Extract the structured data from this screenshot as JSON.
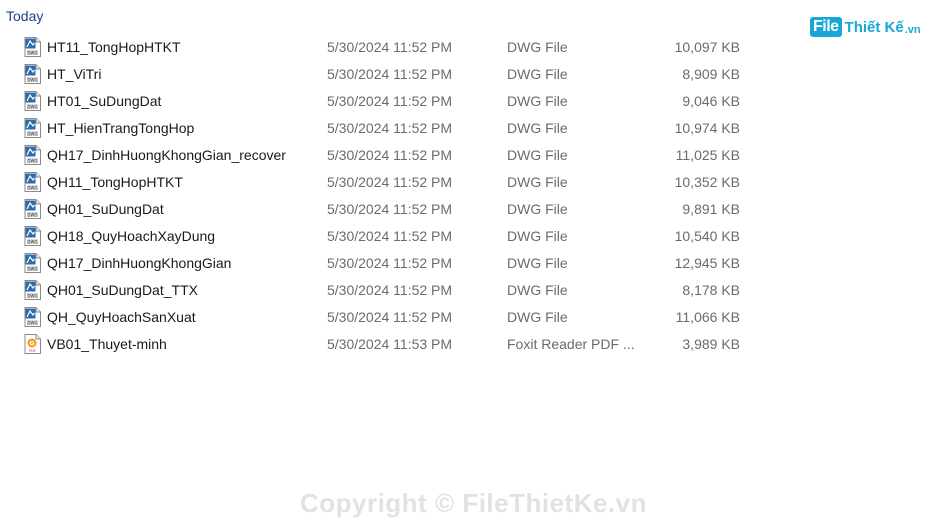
{
  "group_header": "Today",
  "logo": {
    "part1": "File",
    "part2": "Thiết Kế",
    "part3": ".vn",
    "color": "#1aa5d8"
  },
  "files": [
    {
      "name": "HT11_TongHopHTKT",
      "date": "5/30/2024 11:52 PM",
      "type": "DWG File",
      "size": "10,097 KB",
      "icon": "dwg-file-icon"
    },
    {
      "name": "HT_ViTri",
      "date": "5/30/2024 11:52 PM",
      "type": "DWG File",
      "size": "8,909 KB",
      "icon": "dwg-file-icon"
    },
    {
      "name": "HT01_SuDungDat",
      "date": "5/30/2024 11:52 PM",
      "type": "DWG File",
      "size": "9,046 KB",
      "icon": "dwg-file-icon"
    },
    {
      "name": "HT_HienTrangTongHop",
      "date": "5/30/2024 11:52 PM",
      "type": "DWG File",
      "size": "10,974 KB",
      "icon": "dwg-file-icon"
    },
    {
      "name": "QH17_DinhHuongKhongGian_recover",
      "date": "5/30/2024 11:52 PM",
      "type": "DWG File",
      "size": "11,025 KB",
      "icon": "dwg-file-icon"
    },
    {
      "name": "QH11_TongHopHTKT",
      "date": "5/30/2024 11:52 PM",
      "type": "DWG File",
      "size": "10,352 KB",
      "icon": "dwg-file-icon"
    },
    {
      "name": "QH01_SuDungDat",
      "date": "5/30/2024 11:52 PM",
      "type": "DWG File",
      "size": "9,891 KB",
      "icon": "dwg-file-icon"
    },
    {
      "name": "QH18_QuyHoachXayDung",
      "date": "5/30/2024 11:52 PM",
      "type": "DWG File",
      "size": "10,540 KB",
      "icon": "dwg-file-icon"
    },
    {
      "name": "QH17_DinhHuongKhongGian",
      "date": "5/30/2024 11:52 PM",
      "type": "DWG File",
      "size": "12,945 KB",
      "icon": "dwg-file-icon"
    },
    {
      "name": "QH01_SuDungDat_TTX",
      "date": "5/30/2024 11:52 PM",
      "type": "DWG File",
      "size": "8,178 KB",
      "icon": "dwg-file-icon"
    },
    {
      "name": "QH_QuyHoachSanXuat",
      "date": "5/30/2024 11:52 PM",
      "type": "DWG File",
      "size": "11,066 KB",
      "icon": "dwg-file-icon"
    },
    {
      "name": "VB01_Thuyet-minh",
      "date": "5/30/2024 11:53 PM",
      "type": "Foxit Reader PDF ...",
      "size": "3,989 KB",
      "icon": "pdf-file-icon"
    }
  ],
  "watermark": "Copyright © FileThietKe.vn"
}
